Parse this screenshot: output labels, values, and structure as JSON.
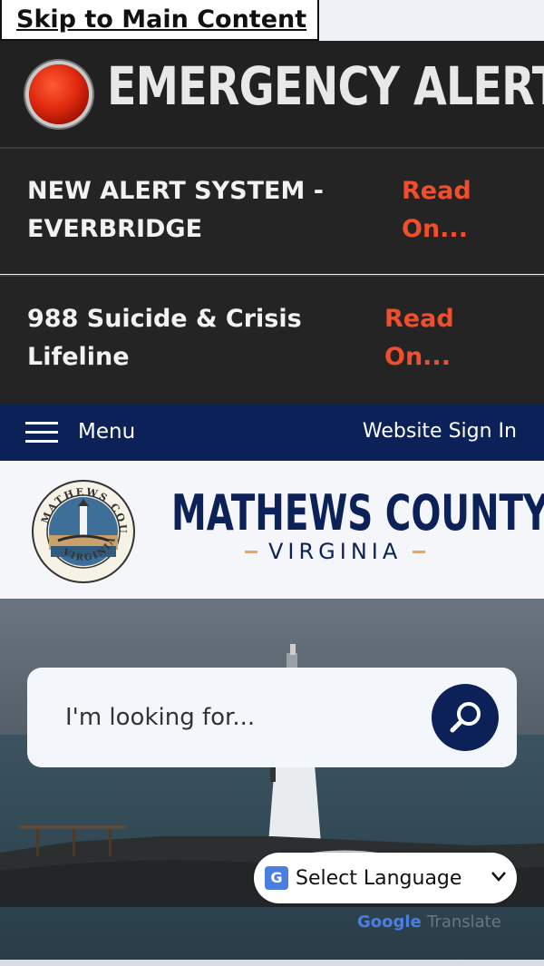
{
  "skip_link": "Skip to Main Content",
  "emergency": {
    "title": "EMERGENCY ALERT",
    "items": [
      {
        "text_line1": "NEW ALERT SYSTEM -",
        "text_line2": "EVERBRIDGE",
        "read_line1": "Read",
        "read_line2": "On..."
      },
      {
        "text_line1": "988 Suicide & Crisis",
        "text_line2": "Lifeline",
        "read_line1": "Read",
        "read_line2": "On..."
      }
    ]
  },
  "nav": {
    "menu_label": "Menu",
    "sign_in": "Website Sign In"
  },
  "header": {
    "county": "MATHEWS COUNTY",
    "state": "VIRGINIA",
    "seal_text_top": "MATHEWS COUNTY",
    "seal_text_bottom": "VIRGINIA"
  },
  "search": {
    "placeholder": "I'm looking for..."
  },
  "translate": {
    "select_label": "Select Language",
    "google": "Google",
    "translate_word": "Translate"
  },
  "colors": {
    "navy": "#0c2157",
    "alert_red": "#f04e2c",
    "dark_bg": "#212121"
  }
}
